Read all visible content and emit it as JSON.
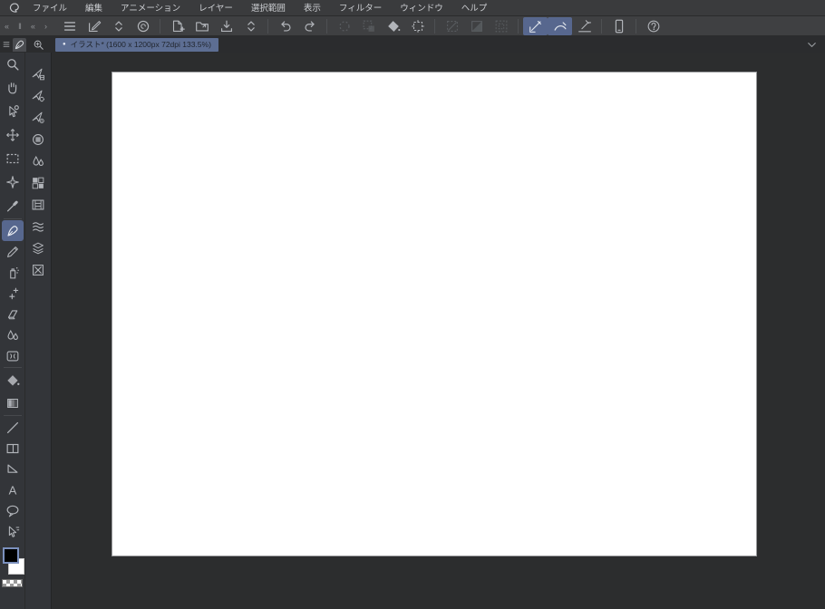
{
  "colors": {
    "menubar_bg": "#3a3b3d",
    "commandbar_bg": "#3f4042",
    "tabbar_bg": "#2b2c2e",
    "strip_bg": "#333539",
    "canvas_area_bg": "#2c2d2e",
    "text": "#cbcdd1",
    "icon": "#b2b5ba",
    "highlight": "#57678e",
    "tab_active_bg": "#5d6e93",
    "swatch_selected_border": "#7b90bd",
    "canvas_bg": "#ffffff"
  },
  "menu_bar": {
    "logo": "clip-studio-logo",
    "items": [
      "ファイル",
      "編集",
      "アニメーション",
      "レイヤー",
      "選択範囲",
      "表示",
      "フィルター",
      "ウィンドウ",
      "ヘルプ"
    ]
  },
  "palette_collapse": {
    "glyphs": [
      "«",
      "‖",
      "«",
      "›"
    ]
  },
  "command_bar": {
    "items": [
      {
        "t": "btn",
        "icon": "main-menu",
        "name": "main-menu-button",
        "state": "normal"
      },
      {
        "t": "btn",
        "icon": "quick-access",
        "name": "quick-access-button",
        "state": "normal"
      },
      {
        "t": "btn",
        "icon": "updown",
        "name": "commandbar-expand-button",
        "state": "normal"
      },
      {
        "t": "btn",
        "icon": "clip-circle",
        "name": "open-clip-studio-button",
        "state": "normal"
      },
      {
        "t": "sep"
      },
      {
        "t": "btn",
        "icon": "new-file",
        "name": "new-file-button",
        "state": "normal"
      },
      {
        "t": "btn",
        "icon": "open-file",
        "name": "open-file-button",
        "state": "normal"
      },
      {
        "t": "btn",
        "icon": "save",
        "name": "save-button",
        "state": "normal"
      },
      {
        "t": "btn",
        "icon": "updown",
        "name": "save-options-button",
        "state": "normal"
      },
      {
        "t": "sep"
      },
      {
        "t": "btn",
        "icon": "undo",
        "name": "undo-button",
        "state": "normal"
      },
      {
        "t": "btn",
        "icon": "redo",
        "name": "redo-button",
        "state": "normal"
      },
      {
        "t": "sep"
      },
      {
        "t": "btn",
        "icon": "select-launch",
        "name": "delete-selection-button",
        "state": "disabled"
      },
      {
        "t": "btn",
        "icon": "sel-layer",
        "name": "clear-outside-selection-button",
        "state": "disabled"
      },
      {
        "t": "btn",
        "icon": "fill-cmd",
        "name": "fill-button",
        "state": "normal"
      },
      {
        "t": "btn",
        "icon": "canvas-size",
        "name": "change-canvas-size-button",
        "state": "normal"
      },
      {
        "t": "sep"
      },
      {
        "t": "btn",
        "icon": "deselect",
        "name": "deselect-button",
        "state": "disabled"
      },
      {
        "t": "btn",
        "icon": "invert-sel",
        "name": "invert-selection-button",
        "state": "disabled"
      },
      {
        "t": "btn",
        "icon": "sel-border",
        "name": "selection-border-button",
        "state": "disabled"
      },
      {
        "t": "sep"
      },
      {
        "t": "btn",
        "icon": "snap-ruler",
        "name": "snap-to-ruler-button",
        "state": "active"
      },
      {
        "t": "btn",
        "icon": "snap-special",
        "name": "snap-to-special-ruler-button",
        "state": "active"
      },
      {
        "t": "btn",
        "icon": "snap-grid",
        "name": "snap-to-grid-button",
        "state": "normal"
      },
      {
        "t": "sep"
      },
      {
        "t": "btn",
        "icon": "tablet",
        "name": "tablet-mode-button",
        "state": "normal"
      },
      {
        "t": "sep"
      },
      {
        "t": "btn",
        "icon": "cs-help",
        "name": "clip-studio-help-button",
        "state": "normal"
      }
    ]
  },
  "document_tab": {
    "bullet": "●",
    "title": "イラスト* (1600 x 1200px 72dpi 133.5%)",
    "overflow_icon": "chevron-down"
  },
  "tool_palette": {
    "header": {
      "menu_icon": "main-menu",
      "tab_icon": "pen"
    },
    "groups": [
      [
        {
          "icon": "zoom",
          "name": "zoom-tool"
        },
        {
          "icon": "hand",
          "name": "hand-tool"
        },
        {
          "icon": "operate",
          "name": "operate-tool"
        },
        {
          "icon": "layer-move",
          "name": "layer-move-tool"
        },
        {
          "icon": "select",
          "name": "selection-area-tool"
        },
        {
          "icon": "auto-select",
          "name": "auto-select-tool"
        },
        {
          "icon": "eyedropper",
          "name": "eyedropper-tool"
        }
      ],
      [
        {
          "icon": "pen",
          "name": "pen-tool",
          "selected": true
        },
        {
          "icon": "pencil",
          "name": "pencil-tool"
        },
        {
          "icon": "airbrush",
          "name": "airbrush-tool"
        },
        {
          "icon": "decoration",
          "name": "decoration-tool"
        },
        {
          "icon": "eraser",
          "name": "eraser-tool"
        },
        {
          "icon": "blend",
          "name": "blend-tool"
        },
        {
          "icon": "liquify",
          "name": "liquify-tool"
        }
      ],
      [
        {
          "icon": "fill-tool",
          "name": "fill-tool"
        },
        {
          "icon": "gradient",
          "name": "gradient-tool"
        }
      ],
      [
        {
          "icon": "figure",
          "name": "figure-tool"
        },
        {
          "icon": "frame-border",
          "name": "frame-border-tool"
        },
        {
          "icon": "ruler-tool",
          "name": "ruler-tool"
        },
        {
          "icon": "text",
          "name": "text-tool"
        },
        {
          "icon": "balloon",
          "name": "balloon-tool"
        },
        {
          "icon": "line-correct",
          "name": "line-correct-tool"
        }
      ]
    ]
  },
  "color_swatches": {
    "main": "#000000",
    "sub": "#ffffff",
    "transparent": "transparent",
    "selected": "main"
  },
  "sub_tool_palette": {
    "header_icon": "zoom-arrow",
    "items": [
      {
        "icon": "kite-ladder",
        "name": "subtool-kite-ladder"
      },
      {
        "icon": "kite-gear",
        "name": "subtool-kite-gear"
      },
      {
        "icon": "kite-target",
        "name": "subtool-kite-target"
      },
      {
        "icon": "circle-square",
        "name": "subtool-circle-frame"
      },
      {
        "icon": "blend",
        "name": "subtool-drops"
      },
      {
        "icon": "grid-panel",
        "name": "subtool-grid-panel"
      },
      {
        "icon": "film",
        "name": "subtool-film"
      },
      {
        "icon": "wave-layers",
        "name": "subtool-wave-layers"
      },
      {
        "icon": "layer-stack",
        "name": "subtool-layer-stack"
      },
      {
        "icon": "crossed-box",
        "name": "subtool-crossed-box"
      }
    ]
  },
  "canvas": {
    "background": "#ffffff"
  }
}
